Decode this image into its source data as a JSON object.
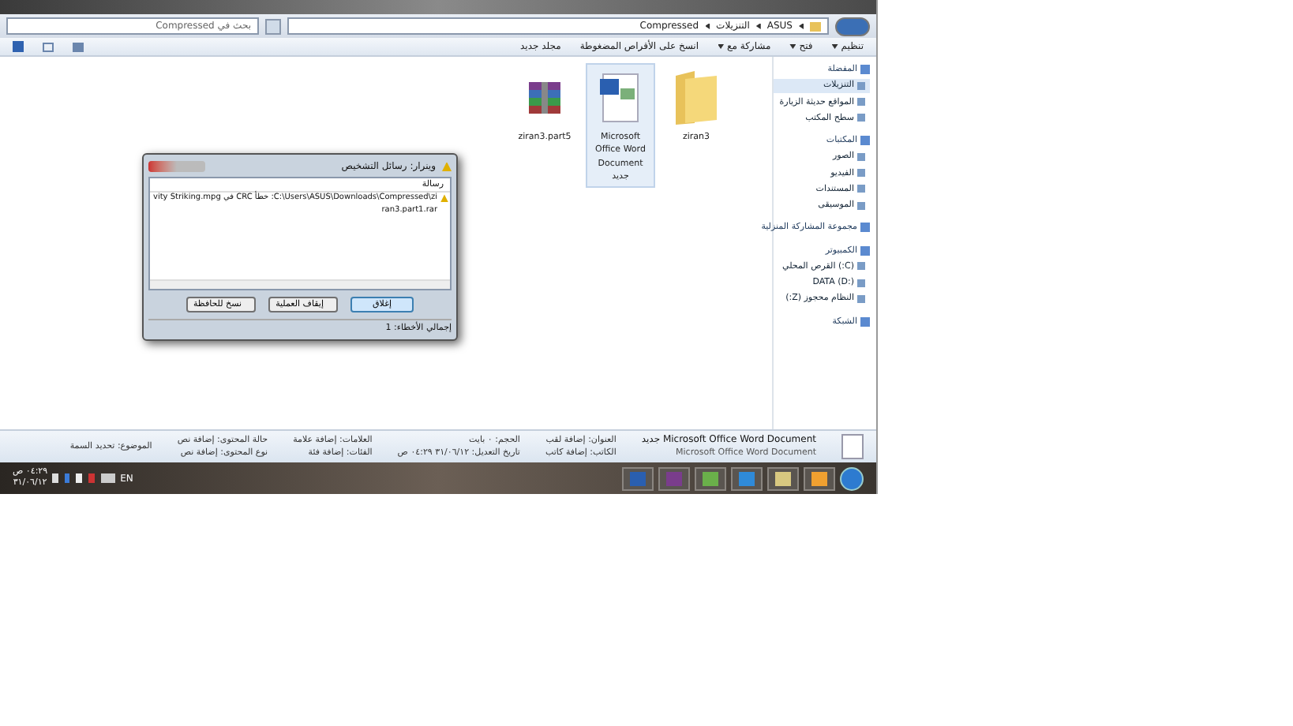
{
  "address": {
    "path": [
      "ASUS",
      "التنزيلات",
      "Compressed"
    ],
    "search_placeholder": "بحث في Compressed"
  },
  "toolbar": [
    {
      "label": "تنظيم",
      "dropdown": true
    },
    {
      "label": "فتح",
      "dropdown": true
    },
    {
      "label": "مشاركة مع",
      "dropdown": true
    },
    {
      "label": "انسخ على الأقراص المضغوطة",
      "dropdown": false
    },
    {
      "label": "مجلد جديد",
      "dropdown": false
    }
  ],
  "nav": [
    {
      "label": "المفضلة",
      "items": [
        {
          "label": "التنزيلات",
          "selected": true
        },
        {
          "label": "المواقع حديثة الزيارة",
          "selected": false
        },
        {
          "label": "سطح المكتب",
          "selected": false
        }
      ]
    },
    {
      "label": "المكتبات",
      "items": [
        {
          "label": "الصور",
          "selected": false
        },
        {
          "label": "الفيديو",
          "selected": false
        },
        {
          "label": "المستندات",
          "selected": false
        },
        {
          "label": "الموسيقى",
          "selected": false
        }
      ]
    },
    {
      "label": "مجموعة المشاركة المنزلية"
    },
    {
      "label": "الكمبيوتر",
      "items": [
        {
          "label": "(C:) القرص المحلي",
          "selected": false
        },
        {
          "label": "DATA (D:)",
          "selected": false
        },
        {
          "label": "النظام محجوز (Z:)",
          "selected": false
        }
      ]
    },
    {
      "label": "الشبكة"
    }
  ],
  "files": [
    {
      "kind": "folder",
      "name": "ziran3",
      "selected": false
    },
    {
      "kind": "document",
      "name": "Microsoft Office Word Document جديد",
      "selected": true
    },
    {
      "kind": "archive",
      "name": "ziran3.part5",
      "selected": false
    }
  ],
  "dialog": {
    "title": "وينرار: رسائل التشخيص",
    "column": "رسالة",
    "messages": [
      "vity Striking.mpg في CRC خطأ :C:\\Users\\ASUS\\Downloads\\Compressed\\ziran3.part1.rar"
    ],
    "buttons": [
      {
        "label": "إغلاق",
        "selected": true
      },
      {
        "label": "إيقاف العملية",
        "selected": false
      },
      {
        "label": "نسخ للحافظة",
        "selected": false
      }
    ],
    "footer": "إجمالي الأخطاء: 1"
  },
  "details": {
    "name": "Microsoft Office Word Document جديد",
    "type": "Microsoft Office Word Document",
    "fields": [
      [
        "العنوان: إضافة لقب",
        "الكاتب: إضافة كاتب"
      ],
      [
        "الحجم: ٠ بايت",
        "تاريخ التعديل: ٣١/٠٦/١٢ ٠٤:٢٩ ص"
      ],
      [
        "العلامات: إضافة علامة",
        "الفئات: إضافة فئة"
      ],
      [
        "حالة المحتوى: إضافة نص",
        "نوع المحتوى: إضافة نص"
      ],
      [
        "الموضوع: تحديد السمة"
      ]
    ]
  },
  "tray": {
    "language": "EN",
    "time": "٠٤:٢٩ ص",
    "date": "٣١/٠٦/١٢"
  }
}
